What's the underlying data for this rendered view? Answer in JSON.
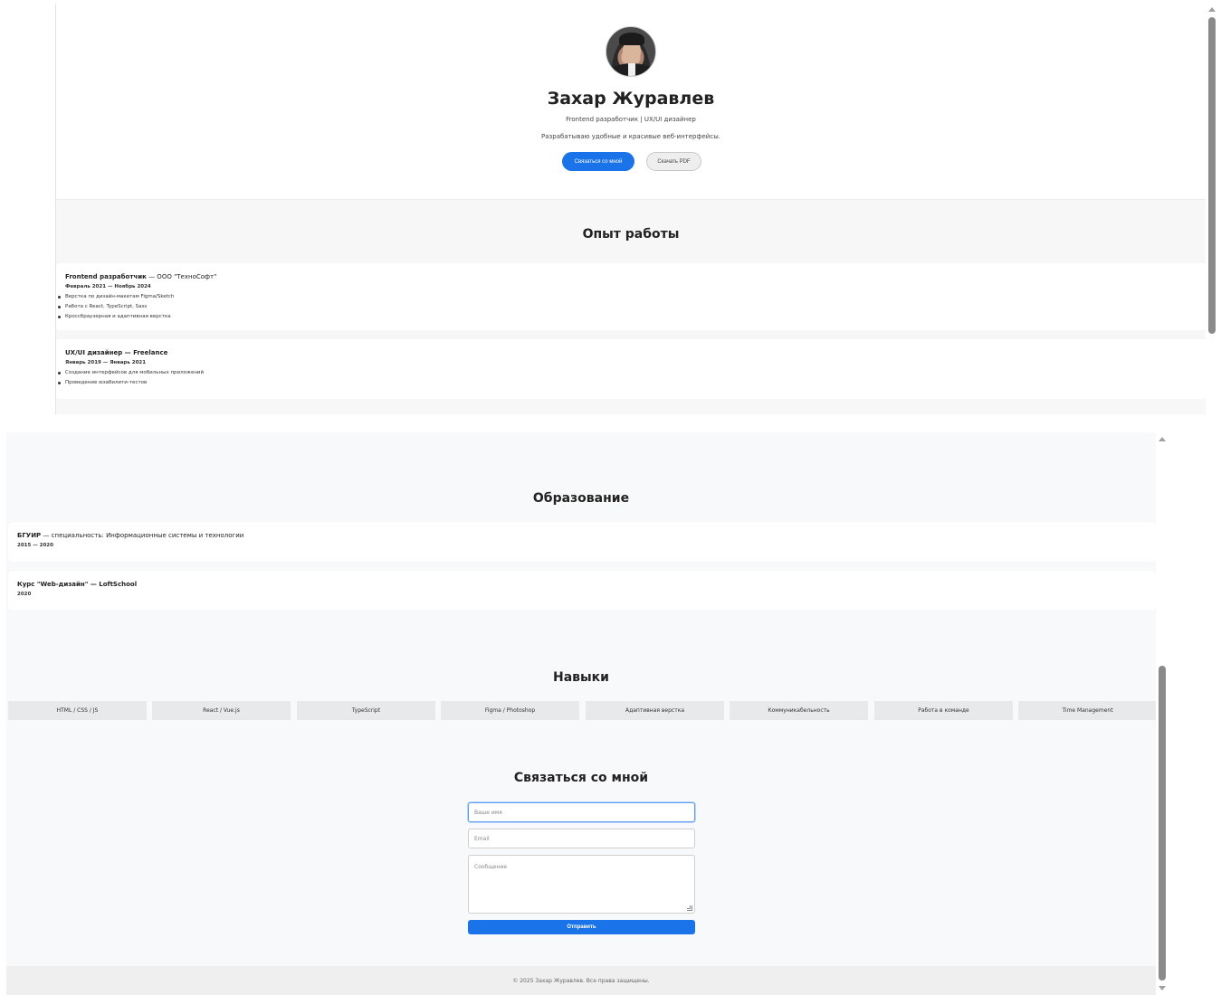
{
  "hero": {
    "name": "Захар Журавлев",
    "role": "Frontend разработчик | UX/UI дизайнер",
    "description": "Разрабатываю удобные и красивые веб-интерфейсы.",
    "contact_button": "Связаться со мной",
    "pdf_button": "Скачать PDF"
  },
  "experience": {
    "title": "Опыт работы",
    "jobs": [
      {
        "position": "Frontend разработчик",
        "company": " — ООО \"ТехноСофт\"",
        "period": "Февраль 2021 — Ноябрь 2024",
        "duties": [
          "Верстка по дизайн-макетам Figma/Sketch",
          "Работа с React, TypeScript, Sass",
          "Кроссбраузерная и адаптивная верстка"
        ]
      },
      {
        "position": "UX/UI дизайнер — Freelance",
        "company": "",
        "period": "Январь 2019 — Январь 2021",
        "duties": [
          "Создание интерфейсов для мобильных приложений",
          "Проведение юзабилити-тестов"
        ]
      }
    ]
  },
  "education": {
    "title": "Образование",
    "items": [
      {
        "name": "БГУИР",
        "detail": " — специальность: Информационные системы и технологии",
        "years": "2015 — 2020"
      },
      {
        "name": "Курс \"Web-дизайн\" — LoftSchool",
        "detail": "",
        "years": "2020"
      }
    ]
  },
  "skills": {
    "title": "Навыки",
    "items": [
      "HTML / CSS / JS",
      "React / Vue.js",
      "TypeScript",
      "Figma / Photoshop",
      "Адаптивная верстка",
      "Коммуникабельность",
      "Работа в команде",
      "Time Management"
    ]
  },
  "contact": {
    "title": "Связаться со мной",
    "name_placeholder": "Ваше имя",
    "email_placeholder": "Email",
    "message_placeholder": "Сообщение",
    "submit": "Отправить"
  },
  "footer": {
    "text": "© 2025 Захар Журавлев. Все права защищены."
  },
  "colors": {
    "accent": "#1a73e8",
    "section_bg": "#f8f9fa",
    "skill_bg": "#e7e9eb"
  },
  "icons": [
    "avatar-photo",
    "scroll-up-arrow",
    "scroll-down-arrow",
    "resize-grip-icon"
  ]
}
